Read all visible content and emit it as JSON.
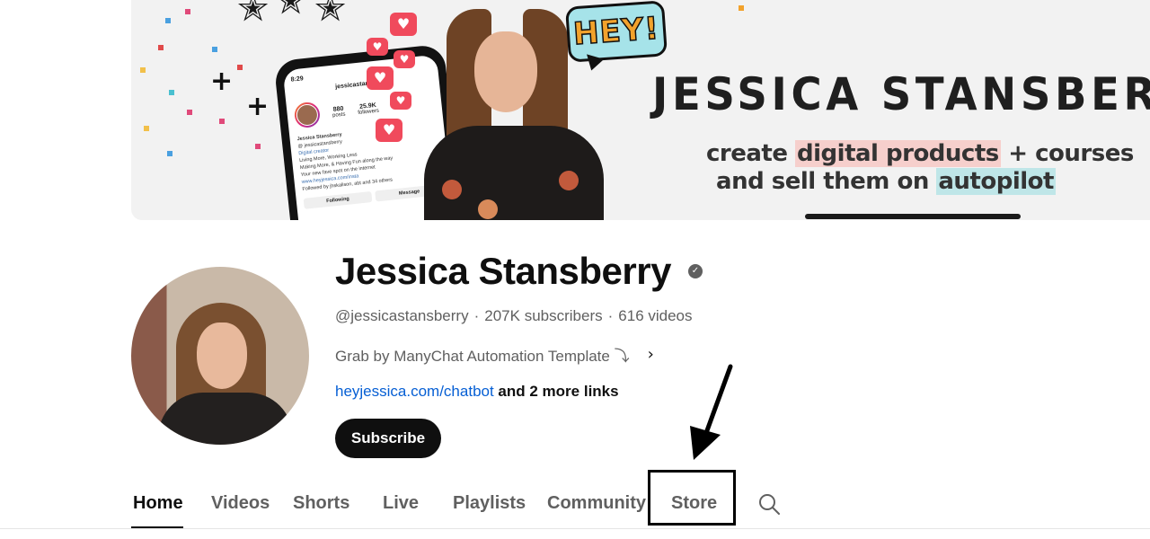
{
  "banner": {
    "title": "JESSICA STANSBERRY",
    "tagline_part1": "create ",
    "tagline_highlight1": "digital products",
    "tagline_part2": " + courses",
    "tagline_part3": "and sell them on ",
    "tagline_highlight2": "autopilot",
    "speech_bubble": "HEY!",
    "phone": {
      "time": "8:29",
      "handle": "jessicastansberry",
      "stat1_value": "880",
      "stat1_label": "posts",
      "stat2_value": "25.9K",
      "stat2_label": "followers",
      "name": "Jessica Stansberry",
      "bio_line1": "@ jessicastansberry",
      "bio_line2": "Digital creator",
      "bio_line3": "Living More, Working Less",
      "bio_line4": "Making More, & Having Fun along the way",
      "bio_line5": "Your new fave spot on the internet",
      "bio_link": "www.heyjessica.com/insta",
      "followed_by": "Followed by jhskalison, abt and 34 others",
      "follow_button": "Following",
      "message_button": "Message"
    }
  },
  "channel": {
    "name": "Jessica Stansberry",
    "handle": "@jessicastansberry",
    "subscribers": "207K subscribers",
    "videos": "616 videos",
    "separator": "·",
    "description": "Grab by ManyChat Automation Template ⤵",
    "description_chevron": "›",
    "link_main": "heyjessica.com/chatbot",
    "link_more": " and 2 more links",
    "subscribe_label": "Subscribe"
  },
  "tabs": [
    {
      "label": "Home",
      "active": true
    },
    {
      "label": "Videos",
      "active": false
    },
    {
      "label": "Shorts",
      "active": false
    },
    {
      "label": "Live",
      "active": false
    },
    {
      "label": "Playlists",
      "active": false
    },
    {
      "label": "Community",
      "active": false
    },
    {
      "label": "Store",
      "active": false,
      "highlighted": true
    }
  ],
  "colors": {
    "link": "#065fd4",
    "text_secondary": "#606060",
    "text_primary": "#0f0f0f",
    "subscribe_bg": "#0f0f0f"
  },
  "icons": {
    "verified": "verified-check-icon",
    "search": "search-icon",
    "annotation": "arrow-annotation"
  }
}
